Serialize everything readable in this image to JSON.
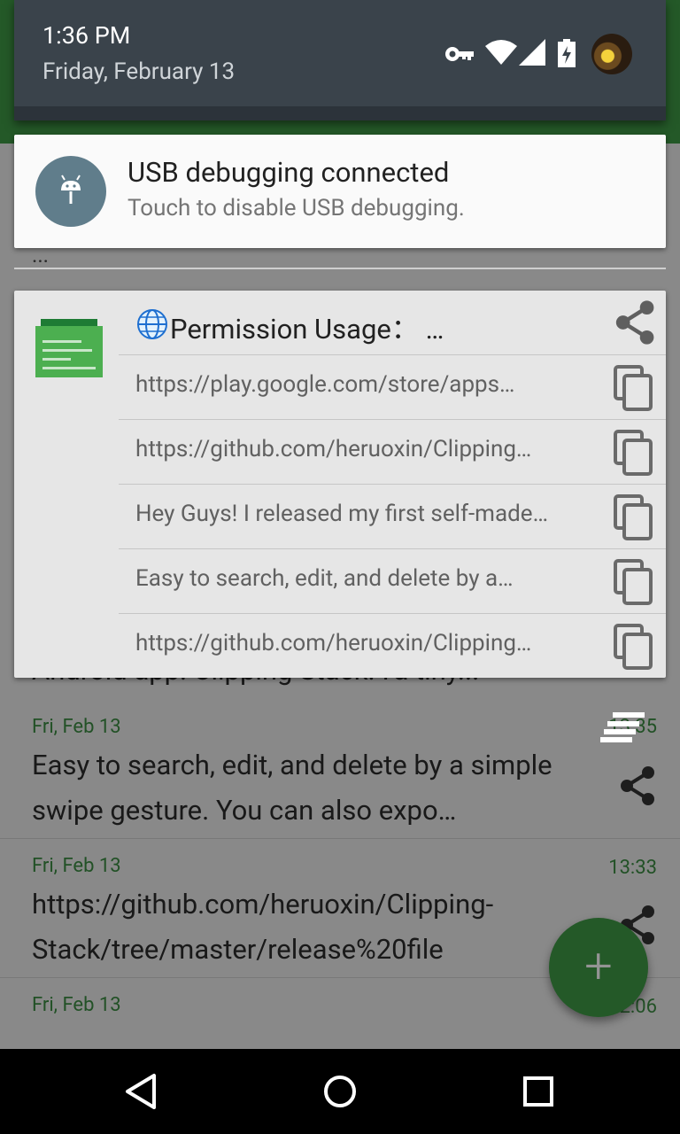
{
  "status": {
    "time": "1:36 PM",
    "date": "Friday, February 13",
    "icons": [
      "key-icon",
      "wifi-icon",
      "signal-icon",
      "battery-charging-icon",
      "avatar"
    ]
  },
  "usb_notification": {
    "title": "USB debugging connected",
    "text": "Touch to disable USB debugging."
  },
  "permission_notification": {
    "title": "Permission Usage：",
    "title_suffix": "…",
    "items": [
      {
        "text": "https://play.google.com/store/apps…"
      },
      {
        "text": "https://github.com/heruoxin/Clipping…"
      },
      {
        "text": "Hey Guys!  I released my first self-made…"
      },
      {
        "text": "Easy to search, edit, and delete by a…"
      },
      {
        "text": "https://github.com/heruoxin/Clipping…"
      }
    ]
  },
  "app_list": {
    "partial_top_text": "...",
    "partial_mid_text": "Android app: Clipping Stack. I'a tiny...",
    "rows": [
      {
        "date": "Fri, Feb 13",
        "time": "13:35",
        "text": "Easy to search, edit, and delete by a simple swipe gesture. You can also expo…"
      },
      {
        "date": "Fri, Feb 13",
        "time": "13:33",
        "text": "https://github.com/heruoxin/Clipping-Stack/tree/master/release%20file"
      },
      {
        "date": "Fri, Feb 13",
        "time": "12:06",
        "text": ""
      }
    ],
    "fab_label": "+"
  },
  "colors": {
    "accent_green": "#3f9a45",
    "qs_background": "#3a434b",
    "usb_icon": "#607d8b"
  }
}
